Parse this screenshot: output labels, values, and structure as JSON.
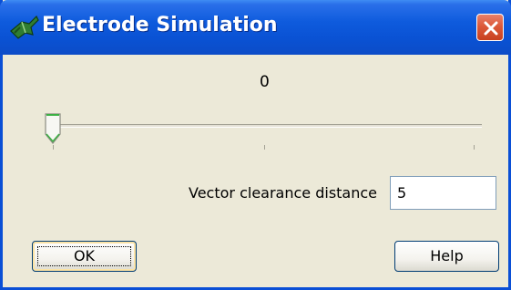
{
  "window": {
    "title": "Electrode Simulation",
    "title_icon": "electrode-app-icon",
    "close_icon": "close-icon"
  },
  "slider": {
    "value_readout": "0",
    "value": 0,
    "thumb_position_fraction": 0
  },
  "vector_clearance": {
    "label": "Vector clearance distance",
    "value": "5"
  },
  "buttons": {
    "ok_label": "OK",
    "help_label": "Help"
  },
  "colors": {
    "titlebar": "#0a52d4",
    "close_button": "#dc5a3a",
    "dialog_background": "#ece9d8",
    "slider_thumb_accent": "#3cb043"
  }
}
